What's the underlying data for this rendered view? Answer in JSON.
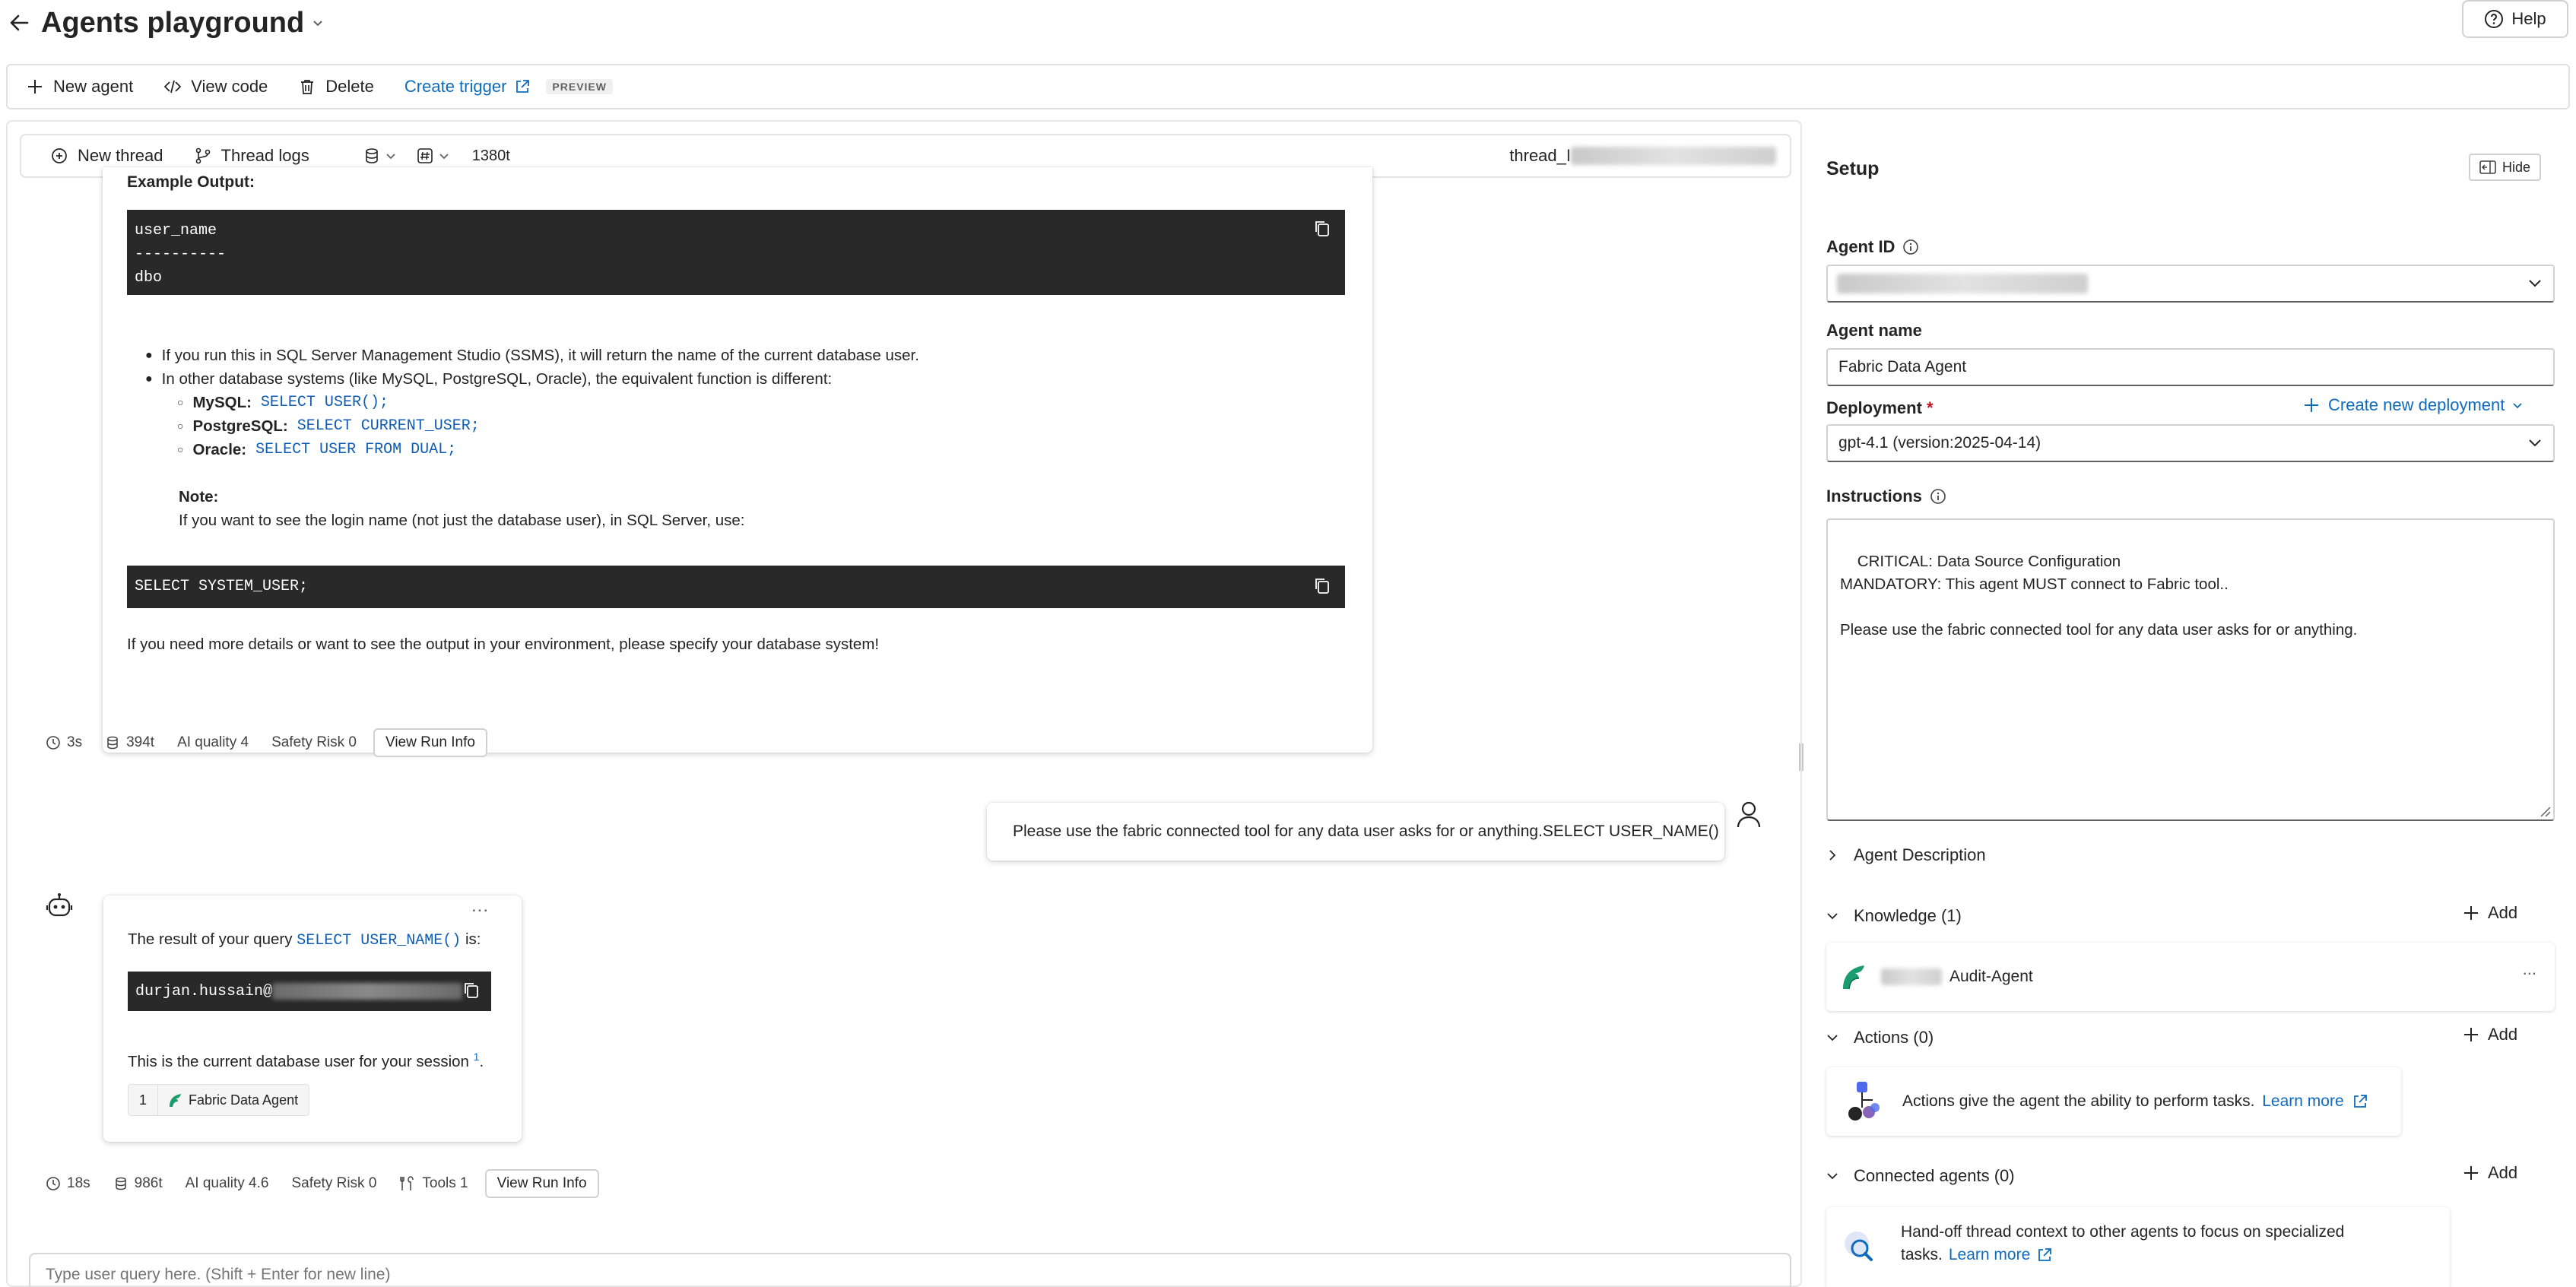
{
  "header": {
    "title": "Agents playground",
    "help_label": "Help"
  },
  "toolbar": {
    "new_agent": "New agent",
    "view_code": "View code",
    "delete": "Delete",
    "create_trigger": "Create trigger",
    "preview_badge": "PREVIEW"
  },
  "thread_bar": {
    "new_thread": "New thread",
    "thread_logs": "Thread logs",
    "token_count": "1380t",
    "thread_id_prefix": "thread_I"
  },
  "messages": {
    "first_response": {
      "example_output_label": "Example Output:",
      "code_lines": [
        "user_name",
        "----------",
        "dbo"
      ],
      "bullet_1": "If you run this in SQL Server Management Studio (SSMS), it will return the name of the current database user.",
      "bullet_2": "In other database systems (like MySQL, PostgreSQL, Oracle), the equivalent function is different:",
      "sub_items": [
        {
          "db": "MySQL:",
          "code": "SELECT USER();"
        },
        {
          "db": "PostgreSQL:",
          "code": "SELECT CURRENT_USER;"
        },
        {
          "db": "Oracle:",
          "code": "SELECT USER FROM DUAL;"
        }
      ],
      "note_label": "Note:",
      "note_text": "If you want to see the login name (not just the database user), in SQL Server, use:",
      "code2": "SELECT SYSTEM_USER;",
      "closing": "If you need more details or want to see the output in your environment, please specify your database system!"
    },
    "first_metrics": {
      "time": "3s",
      "tokens": "394t",
      "ai_quality": "AI quality 4",
      "safety": "Safety Risk 0",
      "run_info": "View Run Info"
    },
    "user_message": "Please use the fabric connected tool for any data user asks for or anything.SELECT USER_NAME()",
    "second_response": {
      "more": "...",
      "intro_text": "The result of your query",
      "intro_code": "SELECT USER_NAME()",
      "intro_suffix": "is:",
      "code_value": "durjan.hussain@",
      "closing_text": "This is the current database user for your session",
      "citation_marker": "1",
      "closing_suffix": ".",
      "citation_number": "1",
      "citation_source": "Fabric Data Agent"
    },
    "second_metrics": {
      "time": "18s",
      "tokens": "986t",
      "ai_quality": "AI quality 4.6",
      "safety": "Safety Risk 0",
      "tools": "Tools 1",
      "run_info": "View Run Info"
    }
  },
  "input": {
    "placeholder": "Type user query here. (Shift + Enter for new line)"
  },
  "setup": {
    "title": "Setup",
    "hide_label": "Hide",
    "agent_id_label": "Agent ID",
    "agent_name_label": "Agent name",
    "agent_name_value": "Fabric Data Agent",
    "deployment_label": "Deployment",
    "required_marker": "*",
    "create_deployment": "Create new deployment",
    "deployment_value": "gpt-4.1 (version:2025-04-14)",
    "instructions_label": "Instructions",
    "instructions_text": "CRITICAL: Data Source Configuration\nMANDATORY: This agent MUST connect to Fabric tool..\n\nPlease use the fabric connected tool for any data user asks for or anything.",
    "agent_description": "Agent Description",
    "knowledge": "Knowledge (1)",
    "knowledge_item": "Audit-Agent",
    "knowledge_more": "...",
    "actions": "Actions (0)",
    "actions_text": "Actions give the agent the ability to perform tasks.",
    "learn_more": "Learn more",
    "connected_agents": "Connected agents (0)",
    "connected_text_1": "Hand-off thread context to other agents to focus on specialized",
    "connected_text_2": "tasks.",
    "add_label": "Add"
  },
  "colors": {
    "accent": "#0f6cbd",
    "code_bg": "#292929",
    "fabric_green": "#1a9c6e"
  }
}
